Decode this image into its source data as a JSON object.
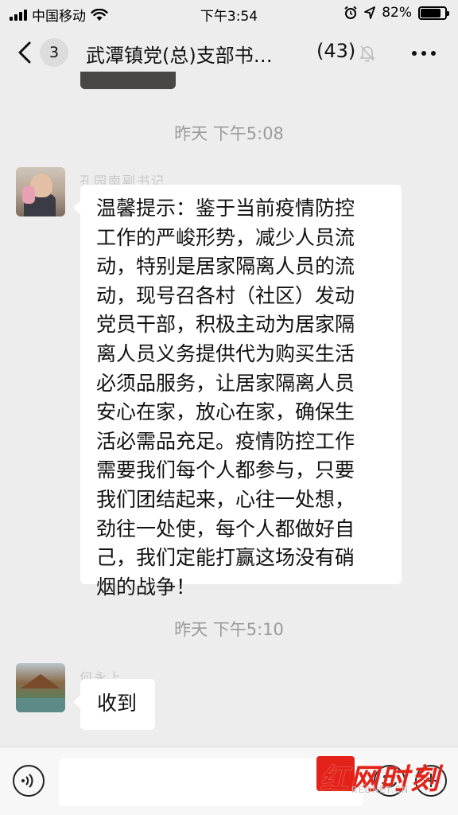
{
  "status_bar": {
    "carrier": "中国移动",
    "time": "下午3:54",
    "battery_percent": "82%",
    "battery_level": 0.82
  },
  "nav": {
    "back_icon": "chevron-left-icon",
    "unread_count": "3",
    "title": "武潭镇党(总)支部书…",
    "member_count": "(43)",
    "mute_icon": "bell-slash-icon",
    "more_icon": "ellipsis-icon"
  },
  "messages": [
    {
      "time": "昨天 下午5:08",
      "sender": "孔园南副书记",
      "lines": [
        "温馨提示：鉴于当前疫情防控",
        "工作的严峻形势，减少人员流",
        "动，特别是居家隔离人员的流",
        "动，现号召各村（社区）发动",
        "党员干部，积极主动为居家隔",
        "离人员义务提供代为购买生活",
        "必须品服务，让居家隔离人员",
        "安心在家，放心在家，确保生",
        "活必需品充足。疫情防控工作",
        "需要我们每个人都参与，只要",
        "我们团结起来，心往一处想，",
        "劲往一处使，每个人都做好自",
        "己，我们定能打赢这场没有硝",
        "烟的战争！"
      ]
    },
    {
      "time": "昨天 下午5:10",
      "sender": "何永上",
      "text": "收到"
    }
  ],
  "input_bar": {
    "voice_icon": "voice-icon",
    "emoji_icon": "emoji-icon",
    "plus_icon": "plus-icon"
  },
  "watermark": {
    "text": "红网时刻",
    "sub": "REDNET.CN",
    "color": "#e32219"
  }
}
